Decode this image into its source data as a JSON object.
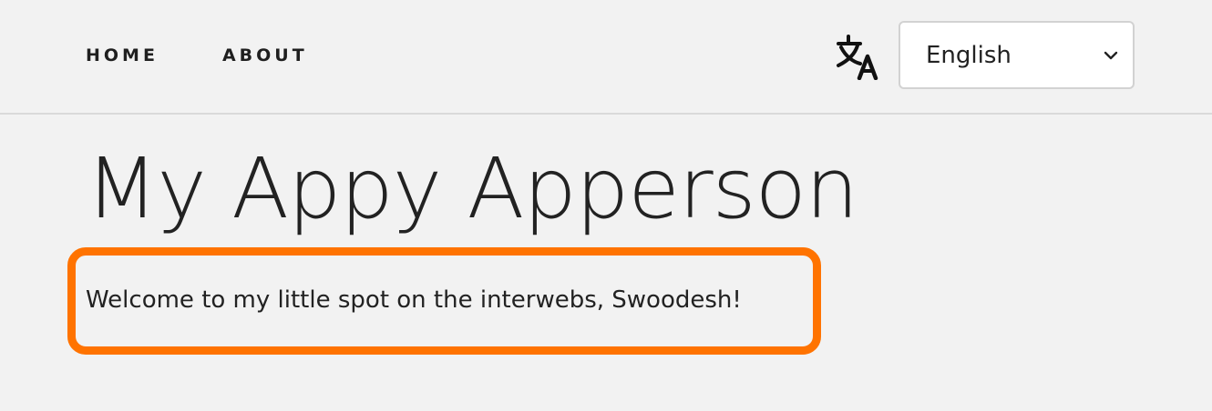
{
  "nav": {
    "home_label": "HOME",
    "about_label": "ABOUT"
  },
  "language": {
    "icon": "translate-icon",
    "selected": "English"
  },
  "page": {
    "title": "My Appy Apperson",
    "welcome": "Welcome to my little spot on the interwebs, Swoodesh!"
  },
  "colors": {
    "background": "#f2f2f2",
    "highlight_border": "#ff7300",
    "text": "#1f1f1f"
  }
}
